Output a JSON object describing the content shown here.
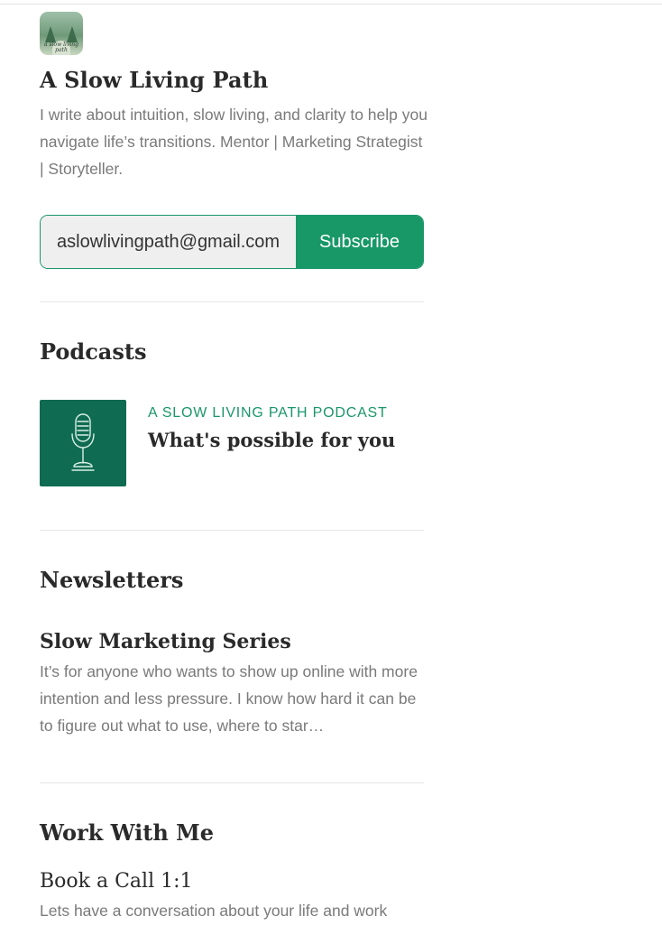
{
  "publication": {
    "logo_text": "a slow living path",
    "name": "A Slow Living Path",
    "description": "I write about intuition, slow living, and clarity to help you navigate life’s transitions. Mentor | Marketing Strategist | Storyteller."
  },
  "subscribe": {
    "email_value": "aslowlivingpath@gmail.com",
    "button_label": "Subscribe",
    "accent_color": "#189866"
  },
  "podcasts": {
    "heading": "Podcasts",
    "items": [
      {
        "kicker": "A Slow Living Path Podcast",
        "title": "What's possible for you",
        "art_icon": "microphone-icon"
      }
    ]
  },
  "newsletters": {
    "heading": "Newsletters",
    "items": [
      {
        "title": "Slow Marketing Series",
        "description": "It’s for anyone who wants to show up online with more intention and less pressure. I know how hard it can be to figure out what to use, where to star…"
      }
    ]
  },
  "work_with_me": {
    "heading": "Work With Me",
    "items": [
      {
        "title": "Book a Call 1:1",
        "description": "Lets have a conversation about your life and work"
      }
    ]
  }
}
